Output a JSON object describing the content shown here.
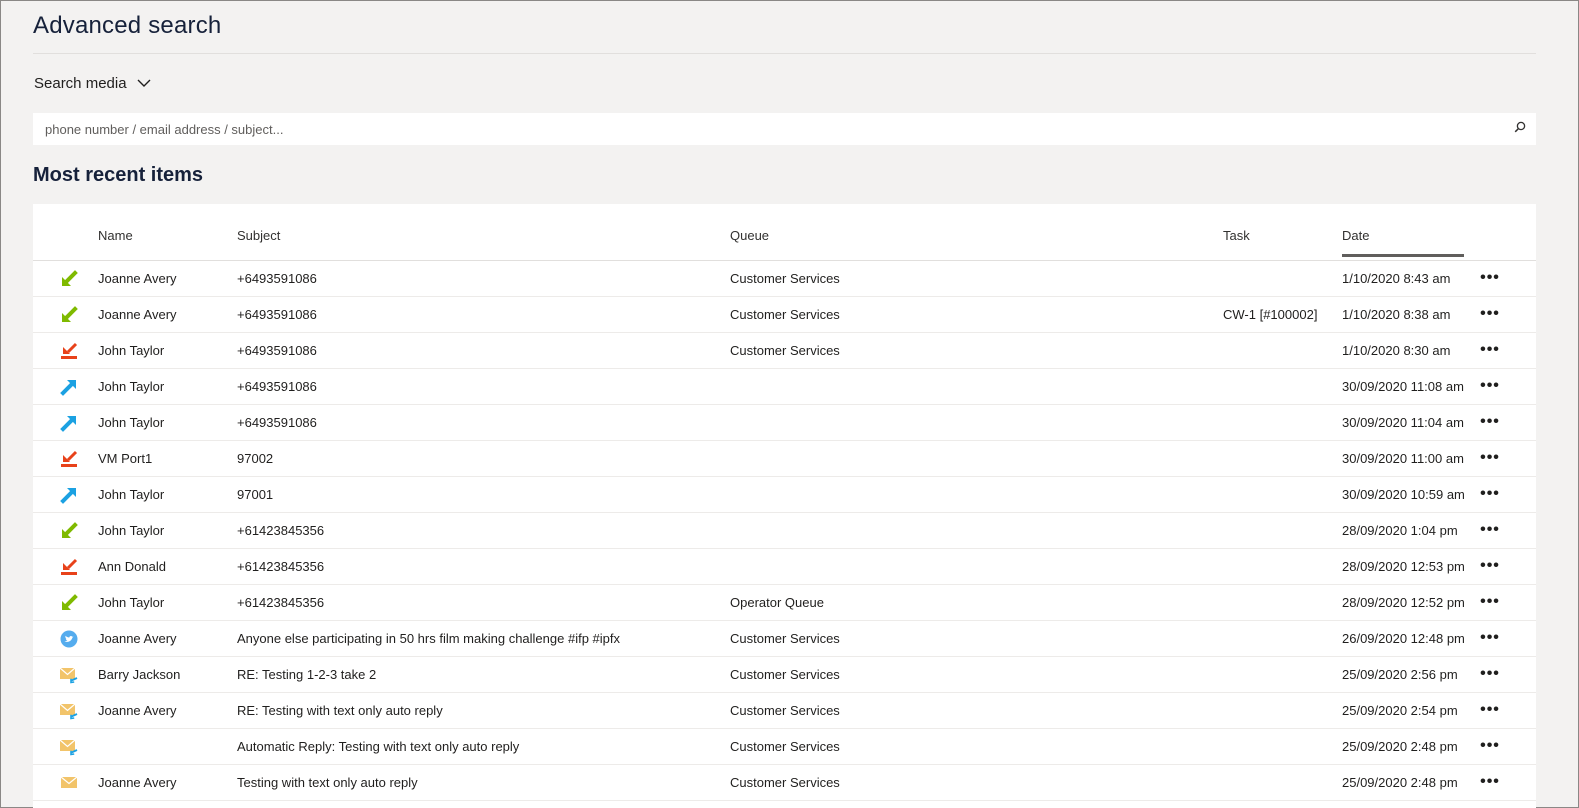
{
  "header": {
    "title": "Advanced search",
    "search_media_label": "Search media",
    "search_placeholder": "phone number / email address / subject...",
    "search_value": ""
  },
  "section_title": "Most recent items",
  "table": {
    "columns": [
      "Name",
      "Subject",
      "Queue",
      "Task",
      "Date"
    ],
    "sorted_column": "Date",
    "rows": [
      {
        "icon": "call-inbound-answered-icon",
        "name": "Joanne Avery",
        "subject": "+6493591086",
        "queue": "Customer Services",
        "task": "",
        "date": "1/10/2020 8:43 am"
      },
      {
        "icon": "call-inbound-answered-icon",
        "name": "Joanne Avery",
        "subject": "+6493591086",
        "queue": "Customer Services",
        "task": "CW-1 [#100002]",
        "date": "1/10/2020 8:38 am"
      },
      {
        "icon": "call-inbound-missed-icon",
        "name": "John Taylor",
        "subject": "+6493591086",
        "queue": "Customer Services",
        "task": "",
        "date": "1/10/2020 8:30 am"
      },
      {
        "icon": "call-outbound-icon",
        "name": "John Taylor",
        "subject": "+6493591086",
        "queue": "",
        "task": "",
        "date": "30/09/2020 11:08 am"
      },
      {
        "icon": "call-outbound-icon",
        "name": "John Taylor",
        "subject": "+6493591086",
        "queue": "",
        "task": "",
        "date": "30/09/2020 11:04 am"
      },
      {
        "icon": "call-inbound-missed-icon",
        "name": "VM Port1",
        "subject": "97002",
        "queue": "",
        "task": "",
        "date": "30/09/2020 11:00 am"
      },
      {
        "icon": "call-outbound-icon",
        "name": "John Taylor",
        "subject": "97001",
        "queue": "",
        "task": "",
        "date": "30/09/2020 10:59 am"
      },
      {
        "icon": "call-inbound-answered-icon",
        "name": "John Taylor",
        "subject": "+61423845356",
        "queue": "",
        "task": "",
        "date": "28/09/2020 1:04 pm"
      },
      {
        "icon": "call-inbound-missed-icon",
        "name": "Ann Donald",
        "subject": "+61423845356",
        "queue": "",
        "task": "",
        "date": "28/09/2020 12:53 pm"
      },
      {
        "icon": "call-inbound-answered-icon",
        "name": "John Taylor",
        "subject": "+61423845356",
        "queue": "Operator Queue",
        "task": "",
        "date": "28/09/2020 12:52 pm"
      },
      {
        "icon": "twitter-icon",
        "name": "Joanne Avery",
        "subject": "Anyone else participating in 50 hrs film making challenge #ifp #ipfx",
        "queue": "Customer Services",
        "task": "",
        "date": "26/09/2020 12:48 pm"
      },
      {
        "icon": "email-reply-icon",
        "name": "Barry Jackson",
        "subject": "RE: Testing 1-2-3 take 2",
        "queue": "Customer Services",
        "task": "",
        "date": "25/09/2020 2:56 pm"
      },
      {
        "icon": "email-reply-icon",
        "name": "Joanne Avery",
        "subject": "RE: Testing with text only auto reply",
        "queue": "Customer Services",
        "task": "",
        "date": "25/09/2020 2:54 pm"
      },
      {
        "icon": "email-reply-icon",
        "name": "",
        "subject": "Automatic Reply: Testing with text only auto reply",
        "queue": "Customer Services",
        "task": "",
        "date": "25/09/2020 2:48 pm"
      },
      {
        "icon": "email-icon",
        "name": "Joanne Avery",
        "subject": "Testing with text only auto reply",
        "queue": "Customer Services",
        "task": "",
        "date": "25/09/2020 2:48 pm"
      }
    ],
    "more_glyph": "•••"
  },
  "colors": {
    "answered": "#7fba00",
    "missed": "#e8421a",
    "outbound": "#1ba1e2",
    "twitter": "#55acee",
    "email": "#f2c46a"
  }
}
